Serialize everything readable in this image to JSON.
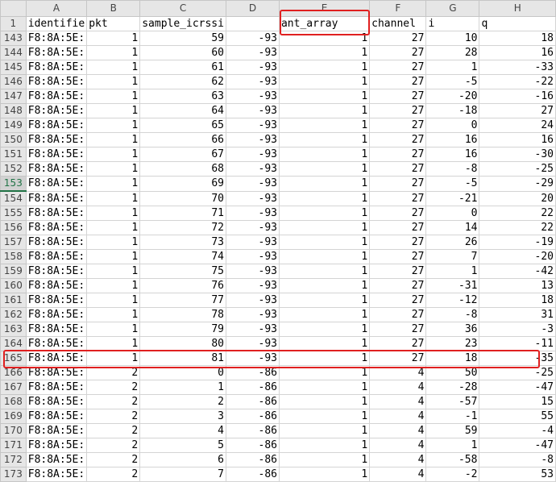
{
  "columns": [
    "A",
    "B",
    "C",
    "D",
    "E",
    "F",
    "G",
    "H"
  ],
  "headers": [
    "identifie",
    "pkt",
    "sample_icrssi",
    "",
    "ant_array",
    "channel",
    "i",
    "q"
  ],
  "rows": [
    {
      "n": "143",
      "a": "F8:8A:5E:",
      "b": "1",
      "c": "59",
      "d": "-93",
      "e": "1",
      "f": "27",
      "g": "10",
      "h": "18"
    },
    {
      "n": "144",
      "a": "F8:8A:5E:",
      "b": "1",
      "c": "60",
      "d": "-93",
      "e": "1",
      "f": "27",
      "g": "28",
      "h": "16"
    },
    {
      "n": "145",
      "a": "F8:8A:5E:",
      "b": "1",
      "c": "61",
      "d": "-93",
      "e": "1",
      "f": "27",
      "g": "1",
      "h": "-33"
    },
    {
      "n": "146",
      "a": "F8:8A:5E:",
      "b": "1",
      "c": "62",
      "d": "-93",
      "e": "1",
      "f": "27",
      "g": "-5",
      "h": "-22"
    },
    {
      "n": "147",
      "a": "F8:8A:5E:",
      "b": "1",
      "c": "63",
      "d": "-93",
      "e": "1",
      "f": "27",
      "g": "-20",
      "h": "-16"
    },
    {
      "n": "148",
      "a": "F8:8A:5E:",
      "b": "1",
      "c": "64",
      "d": "-93",
      "e": "1",
      "f": "27",
      "g": "-18",
      "h": "27"
    },
    {
      "n": "149",
      "a": "F8:8A:5E:",
      "b": "1",
      "c": "65",
      "d": "-93",
      "e": "1",
      "f": "27",
      "g": "0",
      "h": "24"
    },
    {
      "n": "150",
      "a": "F8:8A:5E:",
      "b": "1",
      "c": "66",
      "d": "-93",
      "e": "1",
      "f": "27",
      "g": "16",
      "h": "16"
    },
    {
      "n": "151",
      "a": "F8:8A:5E:",
      "b": "1",
      "c": "67",
      "d": "-93",
      "e": "1",
      "f": "27",
      "g": "16",
      "h": "-30"
    },
    {
      "n": "152",
      "a": "F8:8A:5E:",
      "b": "1",
      "c": "68",
      "d": "-93",
      "e": "1",
      "f": "27",
      "g": "-8",
      "h": "-25"
    },
    {
      "n": "153",
      "a": "F8:8A:5E:",
      "b": "1",
      "c": "69",
      "d": "-93",
      "e": "1",
      "f": "27",
      "g": "-5",
      "h": "-29"
    },
    {
      "n": "154",
      "a": "F8:8A:5E:",
      "b": "1",
      "c": "70",
      "d": "-93",
      "e": "1",
      "f": "27",
      "g": "-21",
      "h": "20"
    },
    {
      "n": "155",
      "a": "F8:8A:5E:",
      "b": "1",
      "c": "71",
      "d": "-93",
      "e": "1",
      "f": "27",
      "g": "0",
      "h": "22"
    },
    {
      "n": "156",
      "a": "F8:8A:5E:",
      "b": "1",
      "c": "72",
      "d": "-93",
      "e": "1",
      "f": "27",
      "g": "14",
      "h": "22"
    },
    {
      "n": "157",
      "a": "F8:8A:5E:",
      "b": "1",
      "c": "73",
      "d": "-93",
      "e": "1",
      "f": "27",
      "g": "26",
      "h": "-19"
    },
    {
      "n": "158",
      "a": "F8:8A:5E:",
      "b": "1",
      "c": "74",
      "d": "-93",
      "e": "1",
      "f": "27",
      "g": "7",
      "h": "-20"
    },
    {
      "n": "159",
      "a": "F8:8A:5E:",
      "b": "1",
      "c": "75",
      "d": "-93",
      "e": "1",
      "f": "27",
      "g": "1",
      "h": "-42"
    },
    {
      "n": "160",
      "a": "F8:8A:5E:",
      "b": "1",
      "c": "76",
      "d": "-93",
      "e": "1",
      "f": "27",
      "g": "-31",
      "h": "13"
    },
    {
      "n": "161",
      "a": "F8:8A:5E:",
      "b": "1",
      "c": "77",
      "d": "-93",
      "e": "1",
      "f": "27",
      "g": "-12",
      "h": "18"
    },
    {
      "n": "162",
      "a": "F8:8A:5E:",
      "b": "1",
      "c": "78",
      "d": "-93",
      "e": "1",
      "f": "27",
      "g": "-8",
      "h": "31"
    },
    {
      "n": "163",
      "a": "F8:8A:5E:",
      "b": "1",
      "c": "79",
      "d": "-93",
      "e": "1",
      "f": "27",
      "g": "36",
      "h": "-3"
    },
    {
      "n": "164",
      "a": "F8:8A:5E:",
      "b": "1",
      "c": "80",
      "d": "-93",
      "e": "1",
      "f": "27",
      "g": "23",
      "h": "-11"
    },
    {
      "n": "165",
      "a": "F8:8A:5E:",
      "b": "1",
      "c": "81",
      "d": "-93",
      "e": "1",
      "f": "27",
      "g": "18",
      "h": "-35"
    },
    {
      "n": "166",
      "a": "F8:8A:5E:",
      "b": "2",
      "c": "0",
      "d": "-86",
      "e": "1",
      "f": "4",
      "g": "50",
      "h": "-25"
    },
    {
      "n": "167",
      "a": "F8:8A:5E:",
      "b": "2",
      "c": "1",
      "d": "-86",
      "e": "1",
      "f": "4",
      "g": "-28",
      "h": "-47"
    },
    {
      "n": "168",
      "a": "F8:8A:5E:",
      "b": "2",
      "c": "2",
      "d": "-86",
      "e": "1",
      "f": "4",
      "g": "-57",
      "h": "15"
    },
    {
      "n": "169",
      "a": "F8:8A:5E:",
      "b": "2",
      "c": "3",
      "d": "-86",
      "e": "1",
      "f": "4",
      "g": "-1",
      "h": "55"
    },
    {
      "n": "170",
      "a": "F8:8A:5E:",
      "b": "2",
      "c": "4",
      "d": "-86",
      "e": "1",
      "f": "4",
      "g": "59",
      "h": "-4"
    },
    {
      "n": "171",
      "a": "F8:8A:5E:",
      "b": "2",
      "c": "5",
      "d": "-86",
      "e": "1",
      "f": "4",
      "g": "1",
      "h": "-47"
    },
    {
      "n": "172",
      "a": "F8:8A:5E:",
      "b": "2",
      "c": "6",
      "d": "-86",
      "e": "1",
      "f": "4",
      "g": "-58",
      "h": "-8"
    },
    {
      "n": "173",
      "a": "F8:8A:5E:",
      "b": "2",
      "c": "7",
      "d": "-86",
      "e": "1",
      "f": "4",
      "g": "-2",
      "h": "53"
    }
  ],
  "selected_row": "153",
  "highlight": {
    "column": "ant_array",
    "row": "165"
  },
  "colors": {
    "highlight_border": "#e02020",
    "selection": "#217346",
    "header_bg": "#e6e6e6",
    "gridline": "#d4d4d4"
  }
}
